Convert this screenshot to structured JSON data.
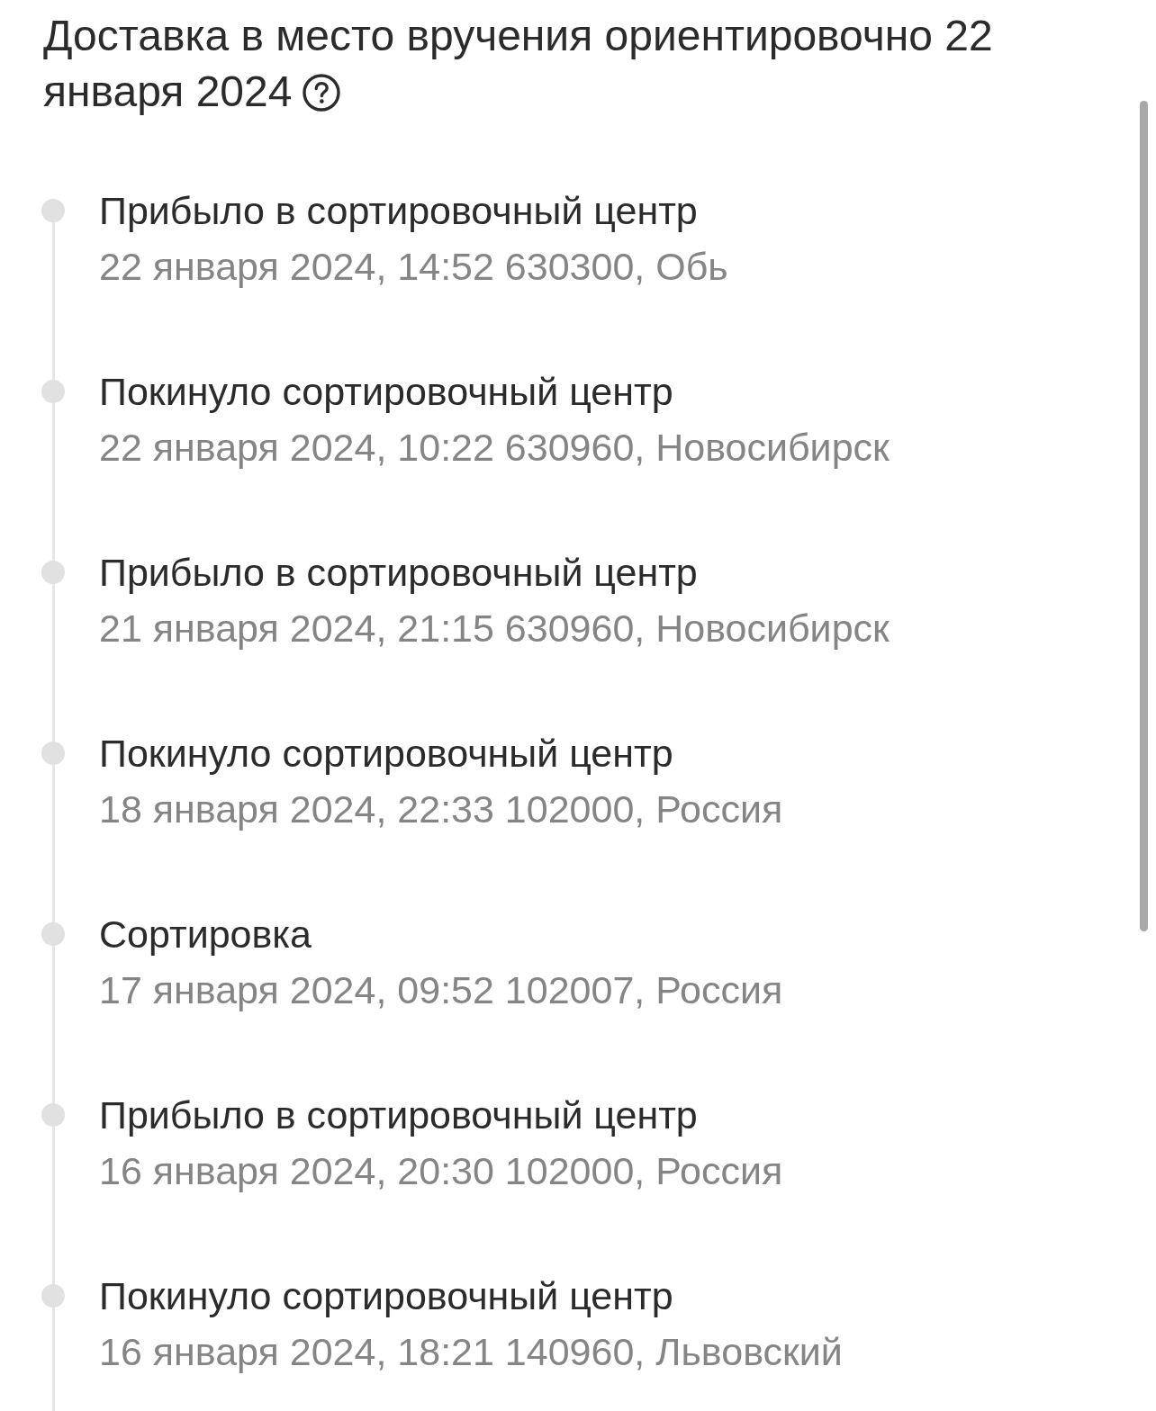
{
  "header": {
    "title": "Доставка в место вручения ориентировочно 22 января 2024"
  },
  "events": [
    {
      "status": "Прибыло в сортировочный центр",
      "details": "22 января 2024, 14:52 630300, Обь"
    },
    {
      "status": "Покинуло сортировочный центр",
      "details": "22 января 2024, 10:22 630960, Новосибирск"
    },
    {
      "status": "Прибыло в сортировочный центр",
      "details": "21 января 2024, 21:15 630960, Новосибирск"
    },
    {
      "status": "Покинуло сортировочный центр",
      "details": "18 января 2024, 22:33 102000, Россия"
    },
    {
      "status": "Сортировка",
      "details": "17 января 2024, 09:52 102007, Россия"
    },
    {
      "status": "Прибыло в сортировочный центр",
      "details": "16 января 2024, 20:30 102000, Россия"
    },
    {
      "status": "Покинуло сортировочный центр",
      "details": "16 января 2024, 18:21 140960, Львовский"
    }
  ]
}
